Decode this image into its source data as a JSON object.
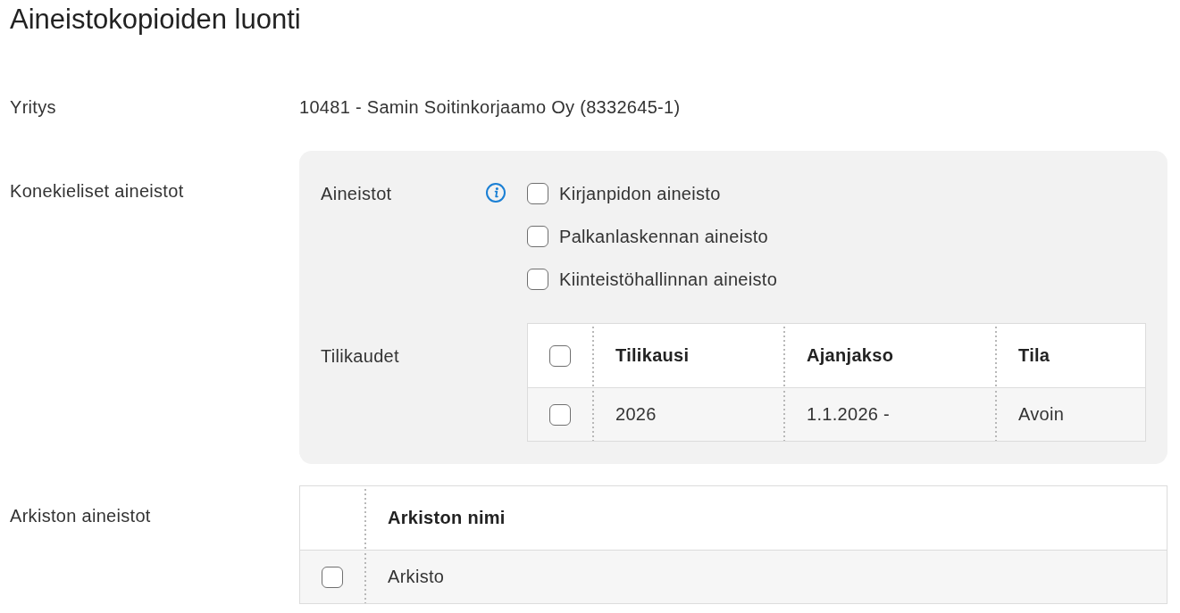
{
  "page": {
    "title": "Aineistokopioiden luonti"
  },
  "company": {
    "label": "Yritys",
    "value": "10481 - Samin Soitinkorjaamo Oy (8332645-1)"
  },
  "machine_readable_materials": {
    "label": "Konekieliset aineistot",
    "materials": {
      "label": "Aineistot",
      "options": [
        {
          "label": "Kirjanpidon aineisto",
          "checked": false
        },
        {
          "label": "Palkanlaskennan aineisto",
          "checked": false
        },
        {
          "label": "Kiinteistöhallinnan aineisto",
          "checked": false
        }
      ]
    },
    "fiscal_periods": {
      "label": "Tilikaudet",
      "select_all": {
        "checked": false
      },
      "columns": [
        "Tilikausi",
        "Ajanjakso",
        "Tila"
      ],
      "rows": [
        {
          "checked": false,
          "cells": [
            "2026",
            "1.1.2026 -",
            "Avoin"
          ]
        }
      ]
    }
  },
  "archive_materials": {
    "label": "Arkiston aineistot",
    "table": {
      "columns": [
        "Arkiston nimi"
      ],
      "rows": [
        {
          "checked": false,
          "cells": [
            "Arkisto"
          ]
        }
      ]
    }
  }
}
